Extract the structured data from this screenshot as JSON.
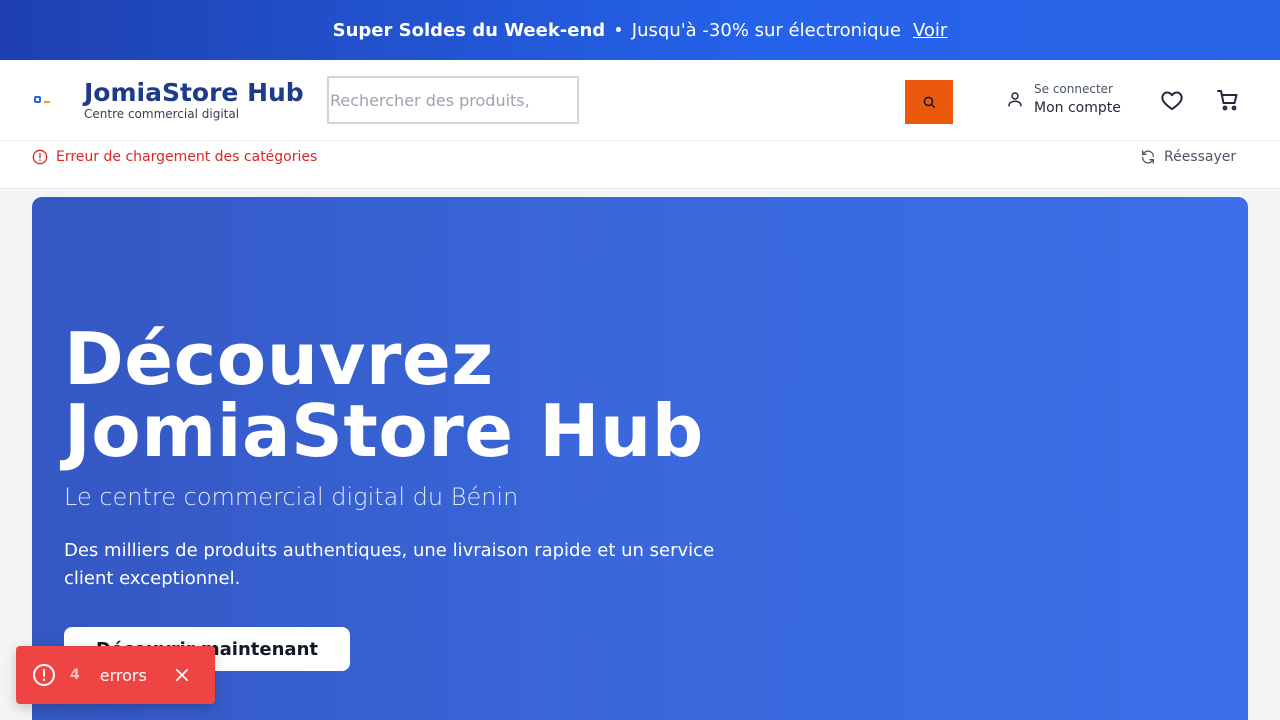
{
  "promo": {
    "headline": "Super Soldes du Week-end",
    "separator": "•",
    "offer": "Jusqu'à -30% sur électronique",
    "link": "Voir"
  },
  "header": {
    "brand": "JomiaStore Hub",
    "tagline": "Centre commercial digital",
    "search_placeholder": "Rechercher des produits,",
    "account_small": "Se connecter",
    "account_big": "Mon compte"
  },
  "categories": {
    "error": "Erreur de chargement des catégories",
    "retry": "Réessayer"
  },
  "hero": {
    "title_line1": "Découvrez",
    "title_line2": "JomiaStore Hub",
    "subtitle": "Le centre commercial digital du Bénin",
    "description": "Des milliers de produits authentiques, une livraison rapide et un service client exceptionnel.",
    "cta": "Découvrir maintenant"
  },
  "toast": {
    "count": "4",
    "label": "errors"
  },
  "colors": {
    "accent": "#2563eb",
    "search_button": "#ea580c",
    "error": "#dc2626",
    "toast": "#ef4444"
  }
}
